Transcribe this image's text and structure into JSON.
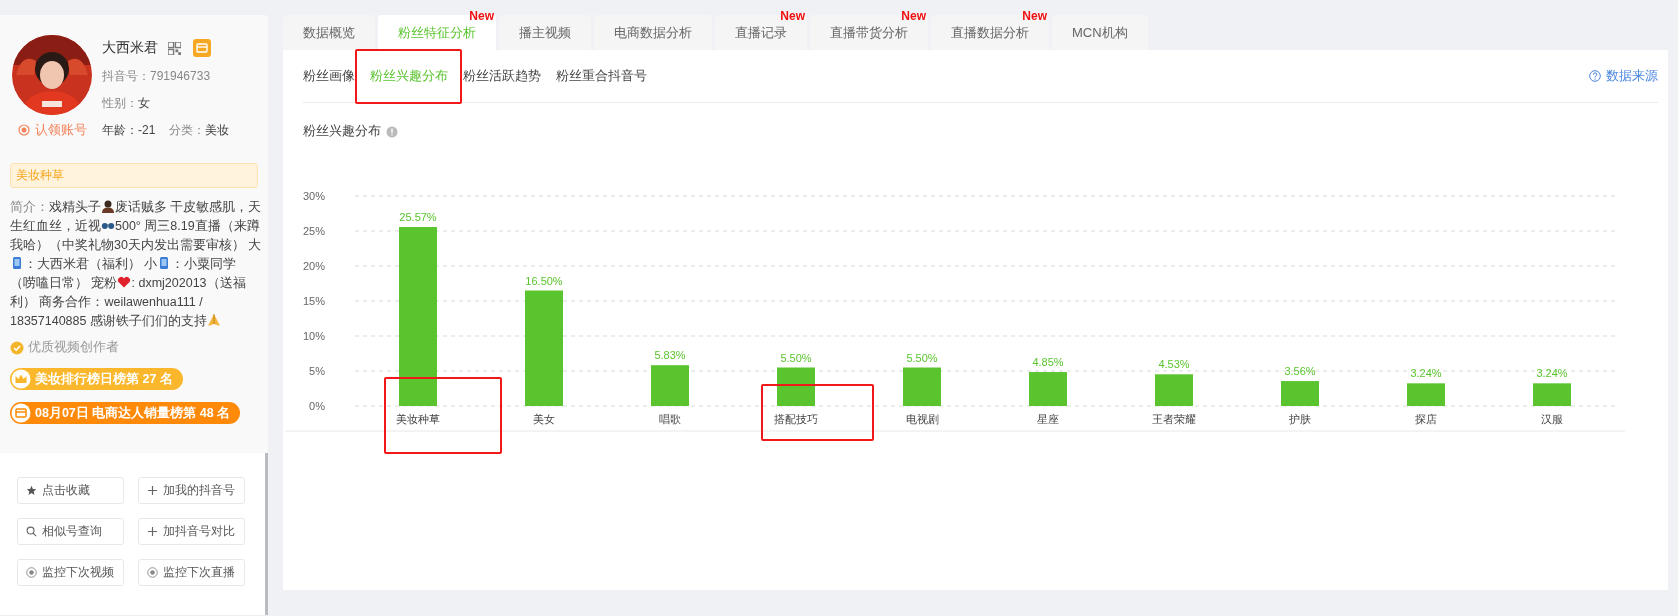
{
  "profile": {
    "name": "大西米君",
    "douyin_id": "抖音号：791946733",
    "gender_label": "性别：",
    "gender": "女",
    "claim": "认领账号",
    "age": "年龄：-21",
    "category_label": "分类：",
    "category": "美妆"
  },
  "tag": "美妆种草",
  "bio": [
    {
      "kind": "label",
      "text": "简介："
    },
    {
      "kind": "text",
      "text": "戏精头子"
    },
    {
      "kind": "person"
    },
    {
      "kind": "text",
      "text": "废话贼多 干皮敏感肌，天生红血丝，近视"
    },
    {
      "kind": "glasses"
    },
    {
      "kind": "text",
      "text": "500° 周三8.19直播（来蹲我哈）（中奖礼物30天内发出需要审核） 大"
    },
    {
      "kind": "phone"
    },
    {
      "kind": "text",
      "text": "：大西米君（福利） 小"
    },
    {
      "kind": "phone"
    },
    {
      "kind": "text",
      "text": "：小粟同学（唠嗑日常） 宠粉"
    },
    {
      "kind": "heart"
    },
    {
      "kind": "text",
      "text": ": dxmj202013（送福利） 商务合作：weilawenhua111 / 18357140885 感谢铁子们们的支持"
    },
    {
      "kind": "pray"
    }
  ],
  "verified": "优质视频创作者",
  "rankings": [
    {
      "kind": "crown",
      "text": "美妆排行榜日榜第 27 名"
    },
    {
      "kind": "shop",
      "text": "08月07日 电商达人销量榜第 48 名"
    }
  ],
  "actions": [
    {
      "kind": "star",
      "label": "点击收藏"
    },
    {
      "kind": "plus",
      "label": "加我的抖音号"
    },
    {
      "kind": "search",
      "label": "相似号查询"
    },
    {
      "kind": "plus",
      "label": "加抖音号对比"
    },
    {
      "kind": "eye",
      "label": "监控下次视频"
    },
    {
      "kind": "eye",
      "label": "监控下次直播"
    }
  ],
  "tabs": [
    {
      "label": "数据概览",
      "selected": false
    },
    {
      "label": "粉丝特征分析",
      "selected": true,
      "badge": "New"
    },
    {
      "label": "播主视频",
      "selected": false
    },
    {
      "label": "电商数据分析",
      "selected": false
    },
    {
      "label": "直播记录",
      "selected": false,
      "badge": "New"
    },
    {
      "label": "直播带货分析",
      "selected": false,
      "badge": "New"
    },
    {
      "label": "直播数据分析",
      "selected": false,
      "badge": "New"
    },
    {
      "label": "MCN机构",
      "selected": false
    }
  ],
  "subtabs": [
    {
      "label": "粉丝画像",
      "selected": false
    },
    {
      "label": "粉丝兴趣分布",
      "selected": true
    },
    {
      "label": "粉丝活跃趋势",
      "selected": false
    },
    {
      "label": "粉丝重合抖音号",
      "selected": false
    }
  ],
  "data_source": "数据来源",
  "chart_title": "粉丝兴趣分布",
  "chart_data": {
    "type": "bar",
    "categories": [
      "美妆种草",
      "美女",
      "唱歌",
      "搭配技巧",
      "电视剧",
      "星座",
      "王者荣耀",
      "护肤",
      "探店",
      "汉服"
    ],
    "values": [
      25.57,
      16.5,
      5.83,
      5.5,
      5.5,
      4.85,
      4.53,
      3.56,
      3.24,
      3.24
    ],
    "grid": true,
    "value_labels": [
      "25.57%",
      "16.50%",
      "5.83%",
      "5.50%",
      "5.50%",
      "4.85%",
      "4.53%",
      "3.56%",
      "3.24%",
      "3.24%"
    ],
    "ylim": [
      0,
      30
    ],
    "yticks": [
      {
        "value": 0,
        "label": "0%"
      },
      {
        "value": 5,
        "label": "5%"
      },
      {
        "value": 10,
        "label": "10%"
      },
      {
        "value": 15,
        "label": "15%"
      },
      {
        "value": 20,
        "label": "20%"
      },
      {
        "value": 25,
        "label": "25%"
      },
      {
        "value": 30,
        "label": "30%"
      }
    ]
  }
}
